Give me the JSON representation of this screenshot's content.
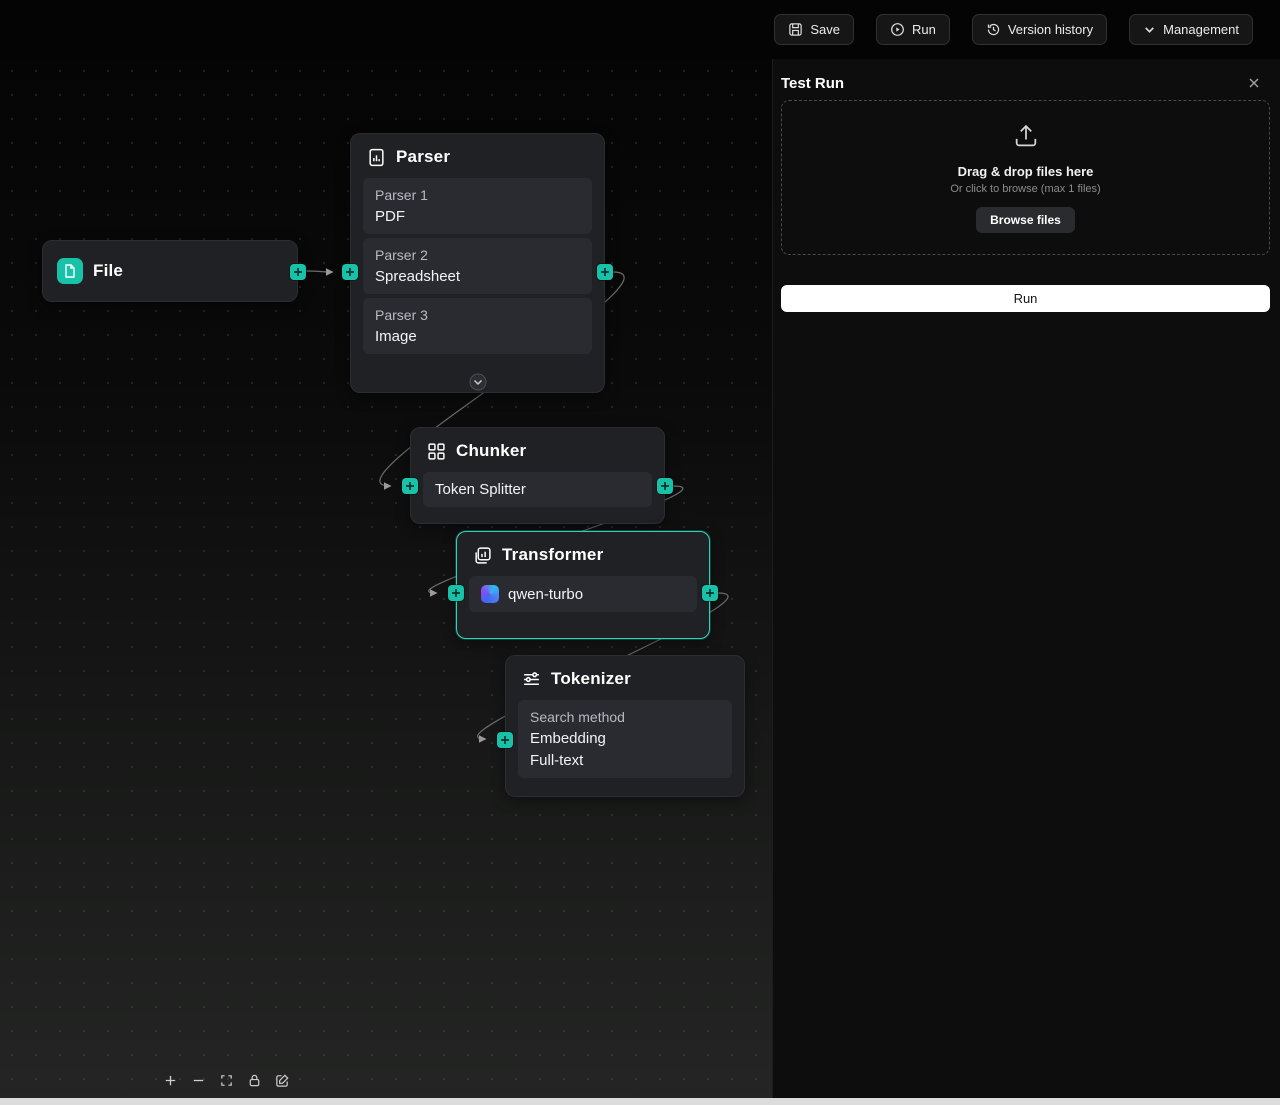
{
  "topbar": {
    "save": "Save",
    "run": "Run",
    "version_history": "Version history",
    "management": "Management"
  },
  "canvas": {
    "file_node": {
      "title": "File"
    },
    "parser_node": {
      "title": "Parser",
      "parsers": [
        {
          "label": "Parser 1",
          "value": "PDF"
        },
        {
          "label": "Parser 2",
          "value": "Spreadsheet"
        },
        {
          "label": "Parser 3",
          "value": "Image"
        }
      ]
    },
    "chunker_node": {
      "title": "Chunker",
      "value": "Token Splitter"
    },
    "transformer_node": {
      "title": "Transformer",
      "model": "qwen-turbo"
    },
    "tokenizer_node": {
      "title": "Tokenizer",
      "search_method_label": "Search method",
      "methods": [
        "Embedding",
        "Full-text"
      ]
    },
    "controls": [
      "zoom-in",
      "zoom-out",
      "fit-view",
      "lock",
      "annotate"
    ]
  },
  "panel": {
    "title": "Test Run",
    "dropzone_title": "Drag & drop files here",
    "dropzone_subtitle": "Or click to browse (max 1 files)",
    "browse_button": "Browse files",
    "run_button": "Run"
  },
  "icons": {
    "topbar": [
      "save-icon",
      "play-circle-icon",
      "history-icon",
      "chevron-down-icon"
    ],
    "nodes": [
      "file-icon",
      "parser-doc-icon",
      "chunker-grid-icon",
      "transformer-icon",
      "tokenizer-lines-icon",
      "qwen-model-icon",
      "plus-handle-icon",
      "collapse-chevron-icon"
    ],
    "panel": [
      "upload-icon",
      "close-icon"
    ]
  },
  "colors": {
    "accent": "#18c2a8",
    "selection": "#2bd4b9",
    "node_bg": "#202125",
    "row_bg": "#2a2b30",
    "panel_bg": "#0d0d0e",
    "edge": "#6d6d6d",
    "run_button_bg": "#ffffff"
  }
}
